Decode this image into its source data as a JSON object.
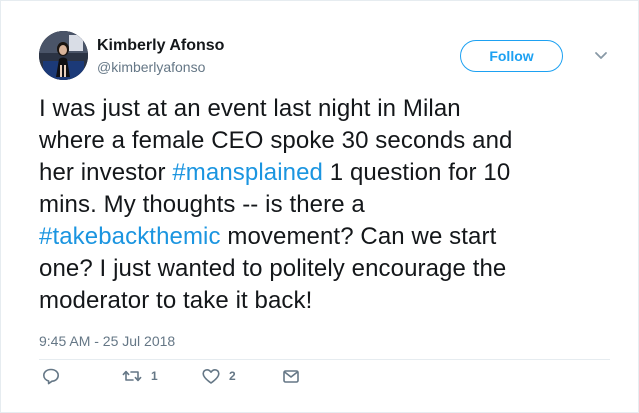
{
  "author": {
    "display_name": "Kimberly Afonso",
    "handle": "@kimberlyafonso"
  },
  "follow_button": {
    "label": "Follow"
  },
  "tweet": {
    "lines": [
      [
        {
          "text": "I was just at an event last night in Milan",
          "hashtag": false
        }
      ],
      [
        {
          "text": "where a female CEO spoke 30 seconds and",
          "hashtag": false
        }
      ],
      [
        {
          "text": "her investor ",
          "hashtag": false
        },
        {
          "text": "#mansplained",
          "hashtag": true
        },
        {
          "text": " 1 question for 10",
          "hashtag": false
        }
      ],
      [
        {
          "text": "mins. My thoughts -- is there a",
          "hashtag": false
        }
      ],
      [
        {
          "text": "#takebackthemic",
          "hashtag": true
        },
        {
          "text": " movement? Can we start",
          "hashtag": false
        }
      ],
      [
        {
          "text": "one? I just wanted to politely encourage the",
          "hashtag": false
        }
      ],
      [
        {
          "text": "moderator to take it back!",
          "hashtag": false
        }
      ]
    ],
    "timestamp": "9:45 AM - 25 Jul 2018"
  },
  "actions": {
    "reply": {
      "icon": "reply-icon",
      "count": ""
    },
    "retweet": {
      "icon": "retweet-icon",
      "count": "1"
    },
    "like": {
      "icon": "heart-icon",
      "count": "2"
    },
    "direct_message": {
      "icon": "envelope-icon",
      "count": ""
    }
  },
  "colors": {
    "accent": "#1da1f2",
    "hashtag": "#1b95e0",
    "text": "#14171a",
    "secondary_text": "#657786"
  }
}
